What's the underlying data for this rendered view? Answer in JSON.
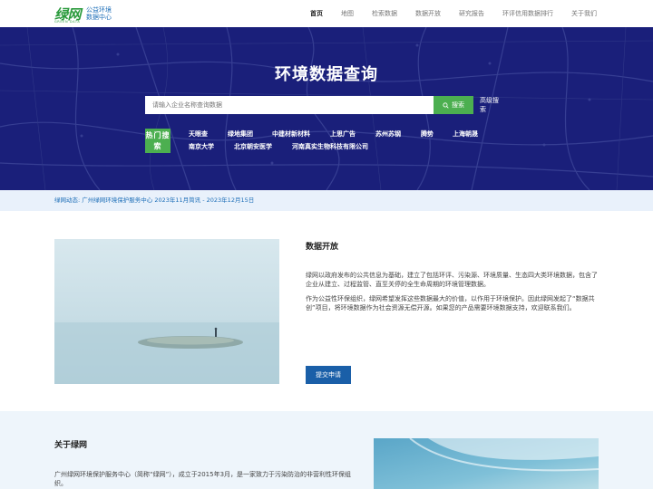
{
  "header": {
    "logo_mark": "绿网",
    "logo_sub": "GREEN DATA",
    "logo_text_1": "公益环境",
    "logo_text_2": "数据中心",
    "nav": [
      {
        "label": "首页",
        "active": true
      },
      {
        "label": "地图"
      },
      {
        "label": "检索数据"
      },
      {
        "label": "数据开放"
      },
      {
        "label": "研究报告"
      },
      {
        "label": "环评信用数据排行"
      },
      {
        "label": "关于我们"
      }
    ]
  },
  "hero": {
    "title": "环境数据查询",
    "search_placeholder": "请输入企业名称查询数据",
    "search_button": "搜索",
    "advanced_search": "高级搜索",
    "hot_label": "热门搜索",
    "hot_tags": [
      "天眼查",
      "绿地集团",
      "中建材新材料",
      "上思广告",
      "苏州苏钢",
      "腾势",
      "上海朝晟",
      "南京大学",
      "北京朝安医学",
      "河南真实生物科技有限公司"
    ]
  },
  "news": {
    "prefix": "绿网动态:",
    "text": "广州绿网环境保护服务中心 2023年11月简讯 - 2023年12月15日"
  },
  "open_data": {
    "title": "数据开放",
    "p1": "绿网以政府发布的公共信息为基础，建立了包括环评、污染源、环境质量、生态四大类环境数据，包含了企业从建立、过程监管、直至关停的全生命周期的环境管理数据。",
    "p2": "作为公益性环保组织，绿网希望发挥这些数据最大的价值，以作用于环境保护。因此绿网发起了“数据共创”项目，将环境数据作为社会资源无偿开源。如果您的产品需要环境数据支持，欢迎联系我们。",
    "button": "提交申请"
  },
  "about": {
    "title": "关于绿网",
    "p1": "广州绿网环境保护服务中心（简称“绿网”），成立于2015年3月，是一家致力于污染防治的非营利性环保组织。"
  },
  "colors": {
    "hero_bg": "#1a1f7a",
    "accent_green": "#4caf50",
    "brand_blue": "#1e6fb8",
    "button_blue": "#1a5fa8"
  }
}
